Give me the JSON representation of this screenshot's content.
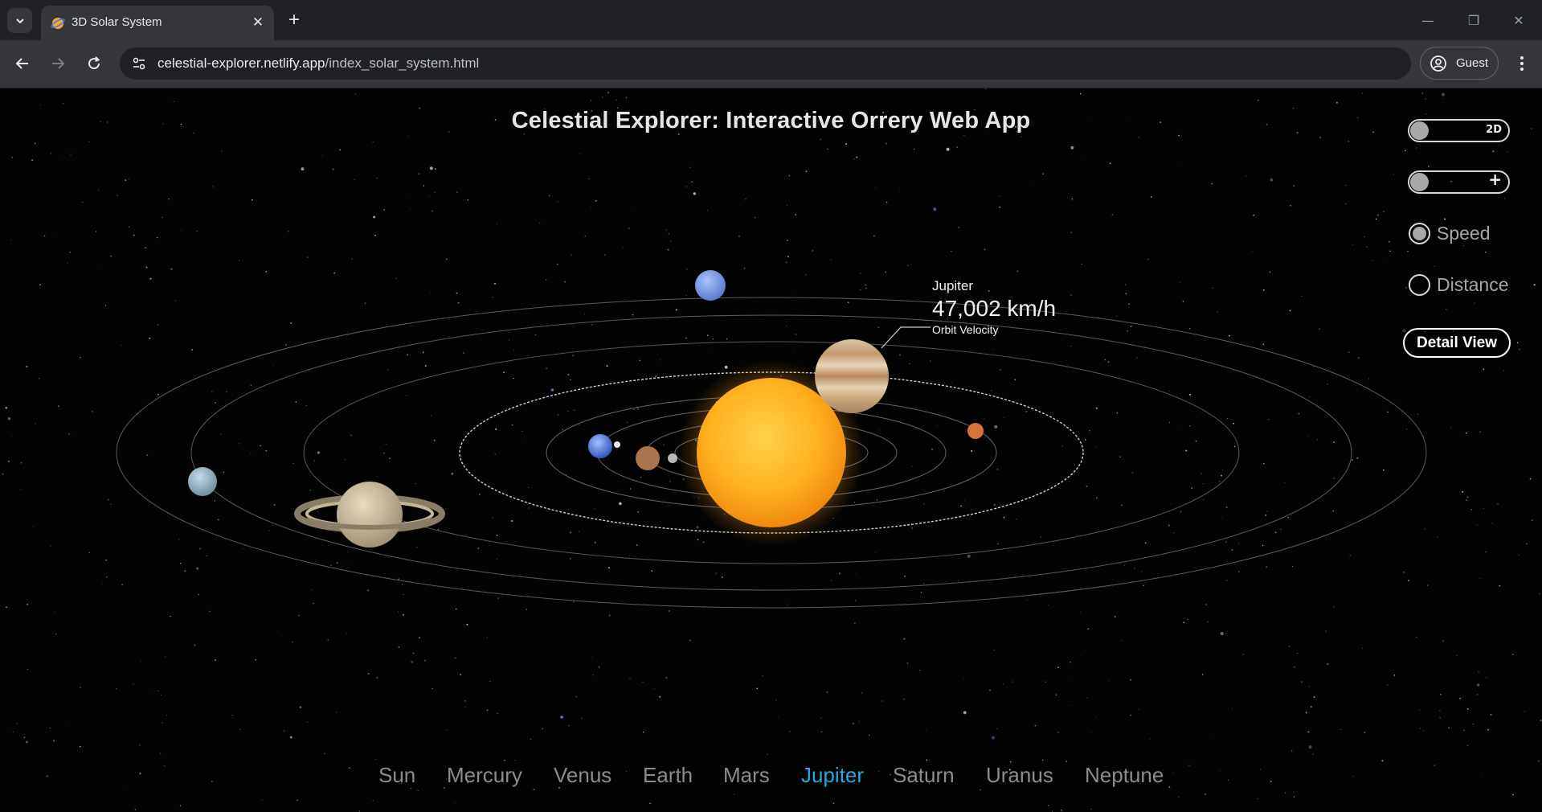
{
  "browser": {
    "tab_title": "3D Solar System",
    "url_domain": "celestial-explorer.netlify.app",
    "url_path": "/index_solar_system.html",
    "profile_label": "Guest"
  },
  "app": {
    "title": "Celestial Explorer: Interactive Orrery Web App",
    "tooltip": {
      "planet": "Jupiter",
      "value": "47,002 km/h",
      "label": "Orbit Velocity"
    },
    "controls": {
      "view_toggle_label": "2D",
      "zoom_toggle_label": "+",
      "radio_speed": "Speed",
      "radio_distance": "Distance",
      "selected_radio": "Speed",
      "detail_button": "Detail View"
    },
    "planet_nav": [
      "Sun",
      "Mercury",
      "Venus",
      "Earth",
      "Mars",
      "Jupiter",
      "Saturn",
      "Uranus",
      "Neptune"
    ],
    "active_planet": "Jupiter",
    "colors": {
      "accent": "#2aa6e0",
      "background": "#030303",
      "sun": "#ffb21f"
    }
  }
}
